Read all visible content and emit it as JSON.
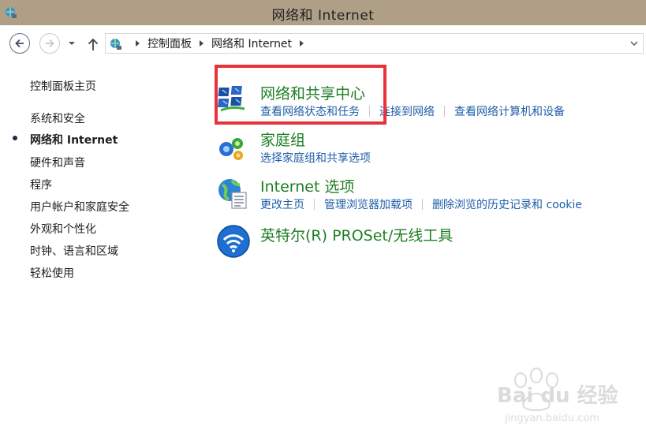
{
  "window": {
    "title": "网络和 Internet"
  },
  "navbar": {
    "breadcrumbs": [
      "控制面板",
      "网络和 Internet"
    ]
  },
  "sidebar": {
    "items": [
      {
        "label": "控制面板主页",
        "active": false
      },
      {
        "label": "系统和安全",
        "active": false
      },
      {
        "label": "网络和 Internet",
        "active": true
      },
      {
        "label": "硬件和声音",
        "active": false
      },
      {
        "label": "程序",
        "active": false
      },
      {
        "label": "用户帐户和家庭安全",
        "active": false
      },
      {
        "label": "外观和个性化",
        "active": false
      },
      {
        "label": "时钟、语言和区域",
        "active": false
      },
      {
        "label": "轻松使用",
        "active": false
      }
    ]
  },
  "main": {
    "categories": [
      {
        "title": "网络和共享中心",
        "icon": "network-sharing-center-icon",
        "links": [
          "查看网络状态和任务",
          "连接到网络",
          "查看网络计算机和设备"
        ]
      },
      {
        "title": "家庭组",
        "icon": "homegroup-icon",
        "links": [
          "选择家庭组和共享选项"
        ]
      },
      {
        "title": "Internet 选项",
        "icon": "internet-options-icon",
        "links": [
          "更改主页",
          "管理浏览器加载项",
          "删除浏览的历史记录和 cookie"
        ]
      },
      {
        "title": "英特尔(R) PROSet/无线工具",
        "icon": "intel-wireless-icon",
        "links": []
      }
    ]
  },
  "watermark": {
    "brand": "Bai du 经验",
    "url": "jingyan.baidu.com"
  },
  "colors": {
    "titlebar": "#b09f87",
    "category_title": "#1e7e24",
    "link": "#1f5ea8",
    "highlight": "#e8333b"
  }
}
